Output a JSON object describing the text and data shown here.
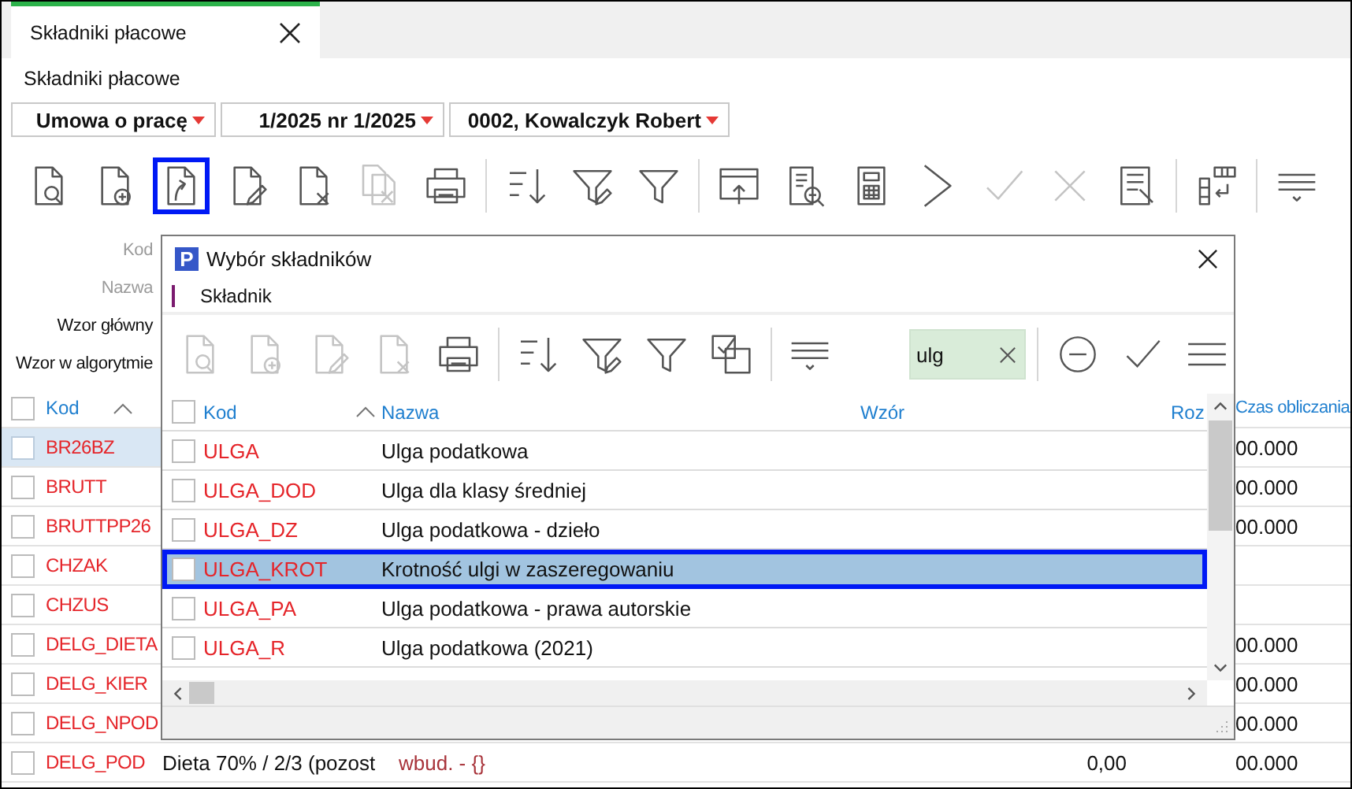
{
  "tab": {
    "label": "Składniki płacowe",
    "selected": true
  },
  "title": "Składniki płacowe",
  "combos": [
    {
      "value": "Umowa o pracę"
    },
    {
      "value": "1/2025 nr 1/2025"
    },
    {
      "value": "0002, Kowalczyk Robert"
    }
  ],
  "toolbar": [
    {
      "kind": "document-search",
      "disabled": false,
      "selected": false
    },
    {
      "kind": "document-add",
      "disabled": false,
      "selected": false
    },
    {
      "kind": "document-import",
      "disabled": false,
      "selected": true
    },
    {
      "kind": "document-edit",
      "disabled": false,
      "selected": false
    },
    {
      "kind": "document-delete",
      "disabled": false,
      "selected": false
    },
    {
      "kind": "documents-delete",
      "disabled": true,
      "selected": false
    },
    {
      "kind": "printer",
      "disabled": false,
      "selected": false
    },
    {
      "kind": "separator"
    },
    {
      "kind": "sort",
      "disabled": false,
      "selected": false
    },
    {
      "kind": "filter-edit",
      "disabled": false,
      "selected": false
    },
    {
      "kind": "filter",
      "disabled": false,
      "selected": false
    },
    {
      "kind": "separator"
    },
    {
      "kind": "window-upload",
      "disabled": false,
      "selected": false
    },
    {
      "kind": "document-lines-search",
      "disabled": false,
      "selected": false
    },
    {
      "kind": "calculator",
      "disabled": false,
      "selected": false
    },
    {
      "kind": "chevron",
      "disabled": false,
      "selected": false
    },
    {
      "kind": "check",
      "disabled": true,
      "selected": false
    },
    {
      "kind": "cross",
      "disabled": true,
      "selected": false
    },
    {
      "kind": "table-edit",
      "disabled": false,
      "selected": false
    },
    {
      "kind": "separator"
    },
    {
      "kind": "columns",
      "disabled": false,
      "selected": false
    },
    {
      "kind": "separator"
    },
    {
      "kind": "lines-dropdown",
      "disabled": false,
      "selected": false
    }
  ],
  "form_labels": [
    {
      "text": "Kod",
      "disabled": true
    },
    {
      "text": "Nazwa",
      "disabled": true
    },
    {
      "text": "Wzor główny",
      "disabled": false
    },
    {
      "text": "Wzor w algorytmie",
      "disabled": false
    }
  ],
  "table": {
    "checked": false,
    "columns": [
      {
        "label": "Kod"
      },
      {
        "label": "Czas obliczania"
      }
    ],
    "rows": [
      {
        "kod": "BR26BZ",
        "czas_obliczania": "00.000",
        "selected": true,
        "checked": false
      },
      {
        "kod": "BRUTT",
        "czas_obliczania": "00.000",
        "selected": false,
        "checked": false
      },
      {
        "kod": "BRUTTPP26",
        "czas_obliczania": "00.000",
        "selected": false,
        "checked": false
      },
      {
        "kod": "CHZAK",
        "selected": false,
        "checked": false
      },
      {
        "kod": "CHZUS",
        "selected": false,
        "checked": false
      },
      {
        "kod": "DELG_DIETA",
        "czas_obliczania": "00.000",
        "selected": false,
        "checked": false
      },
      {
        "kod": "DELG_KIER",
        "czas_obliczania": "00.000",
        "selected": false,
        "checked": false
      },
      {
        "kod": "DELG_NPOD",
        "czas_obliczania": "00.000",
        "selected": false,
        "checked": false
      },
      {
        "kod": "DELG_POD",
        "nazwa": "Dieta 70% / 2/3 (pozost",
        "wzor": "wbud. - {}",
        "column_5": "0,00",
        "czas_obliczania": "00.000",
        "selected": false,
        "checked": false
      }
    ]
  },
  "dialog": {
    "logo": "P",
    "title": "Wybór składników",
    "tab": {
      "label": "Składnik",
      "selected": true
    },
    "toolbar": [
      {
        "kind": "document-search",
        "disabled": true
      },
      {
        "kind": "document-add",
        "disabled": true
      },
      {
        "kind": "document-edit",
        "disabled": true
      },
      {
        "kind": "document-delete",
        "disabled": true
      },
      {
        "kind": "printer",
        "disabled": false
      },
      {
        "kind": "separator"
      },
      {
        "kind": "sort",
        "disabled": false
      },
      {
        "kind": "filter-edit",
        "disabled": false
      },
      {
        "kind": "filter",
        "disabled": false
      },
      {
        "kind": "check-copy",
        "disabled": false
      },
      {
        "kind": "separator"
      },
      {
        "kind": "lines-dropdown",
        "disabled": false
      }
    ],
    "search": {
      "value": "ulg"
    },
    "actions": [
      {
        "kind": "minus-circle",
        "disabled": false
      },
      {
        "kind": "check",
        "disabled": false
      },
      {
        "kind": "menu",
        "disabled": false
      }
    ],
    "table": {
      "checked": false,
      "columns": [
        {
          "label": "Kod"
        },
        {
          "label": "Nazwa"
        },
        {
          "label": "Wzór"
        },
        {
          "label": "Roz"
        }
      ],
      "rows": [
        {
          "kod": "ULGA",
          "nazwa": "Ulga podatkowa",
          "selected": false,
          "checked": false
        },
        {
          "kod": "ULGA_DOD",
          "nazwa": "Ulga dla klasy średniej",
          "selected": false,
          "checked": false
        },
        {
          "kod": "ULGA_DZ",
          "nazwa": "Ulga podatkowa - dzieło",
          "selected": false,
          "checked": false
        },
        {
          "kod": "ULGA_KROT",
          "nazwa": "Krotność ulgi w zaszeregowaniu",
          "selected": true,
          "checked": false
        },
        {
          "kod": "ULGA_PA",
          "nazwa": "Ulga podatkowa - prawa autorskie",
          "selected": false,
          "checked": false
        },
        {
          "kod": "ULGA_R",
          "nazwa": "Ulga podatkowa (2021)",
          "selected": false,
          "checked": false
        }
      ]
    }
  }
}
